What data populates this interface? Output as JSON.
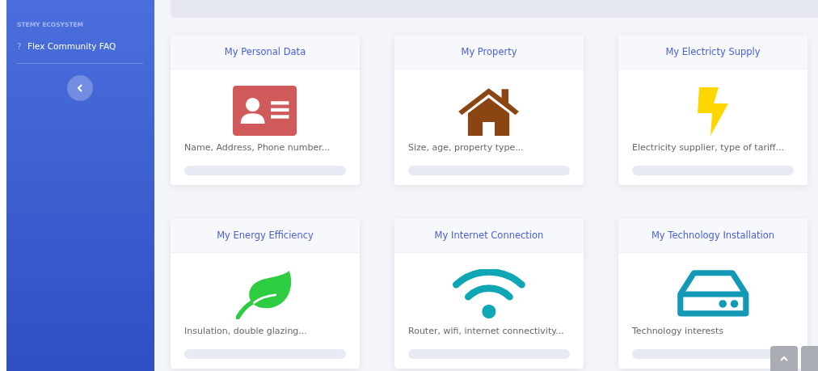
{
  "sidebar": {
    "section_title": "STEMY ECOSYSTEM",
    "items": [
      {
        "icon": "?",
        "label": "Flex Community FAQ"
      }
    ]
  },
  "cards": [
    {
      "title": "My Personal Data",
      "kind": "id-card",
      "color": "#d05a5a",
      "description": "Name, Address, Phone number..."
    },
    {
      "title": "My Property",
      "kind": "house",
      "color": "#8b4513",
      "description": "Size, age, property type..."
    },
    {
      "title": "My Electricty Supply",
      "kind": "bolt",
      "color": "#ffd700",
      "description": "Electricity supplier, type of tariff..."
    },
    {
      "title": "My Energy Efficiency",
      "kind": "leaf",
      "color": "#2ecc40",
      "description": "Insulation, double glazing..."
    },
    {
      "title": "My Internet Connection",
      "kind": "wifi",
      "color": "#0fa6b5",
      "description": "Router, wifi, internet connectivity..."
    },
    {
      "title": "My Technology Installation",
      "kind": "drive",
      "color": "#1199b5",
      "description": "Technology interests"
    }
  ]
}
